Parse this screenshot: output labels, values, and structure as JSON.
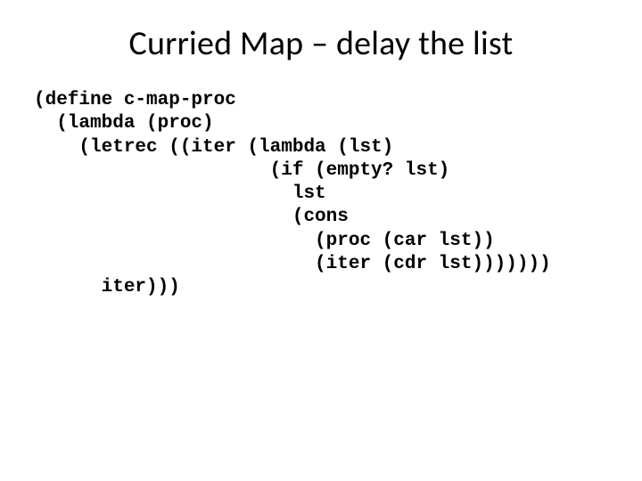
{
  "slide": {
    "title": "Curried Map – delay the list",
    "code": "(define c-map-proc\n  (lambda (proc)\n    (letrec ((iter (lambda (lst)\n                     (if (empty? lst)\n                       lst\n                       (cons\n                         (proc (car lst))\n                         (iter (cdr lst)))))))\n      iter)))"
  }
}
